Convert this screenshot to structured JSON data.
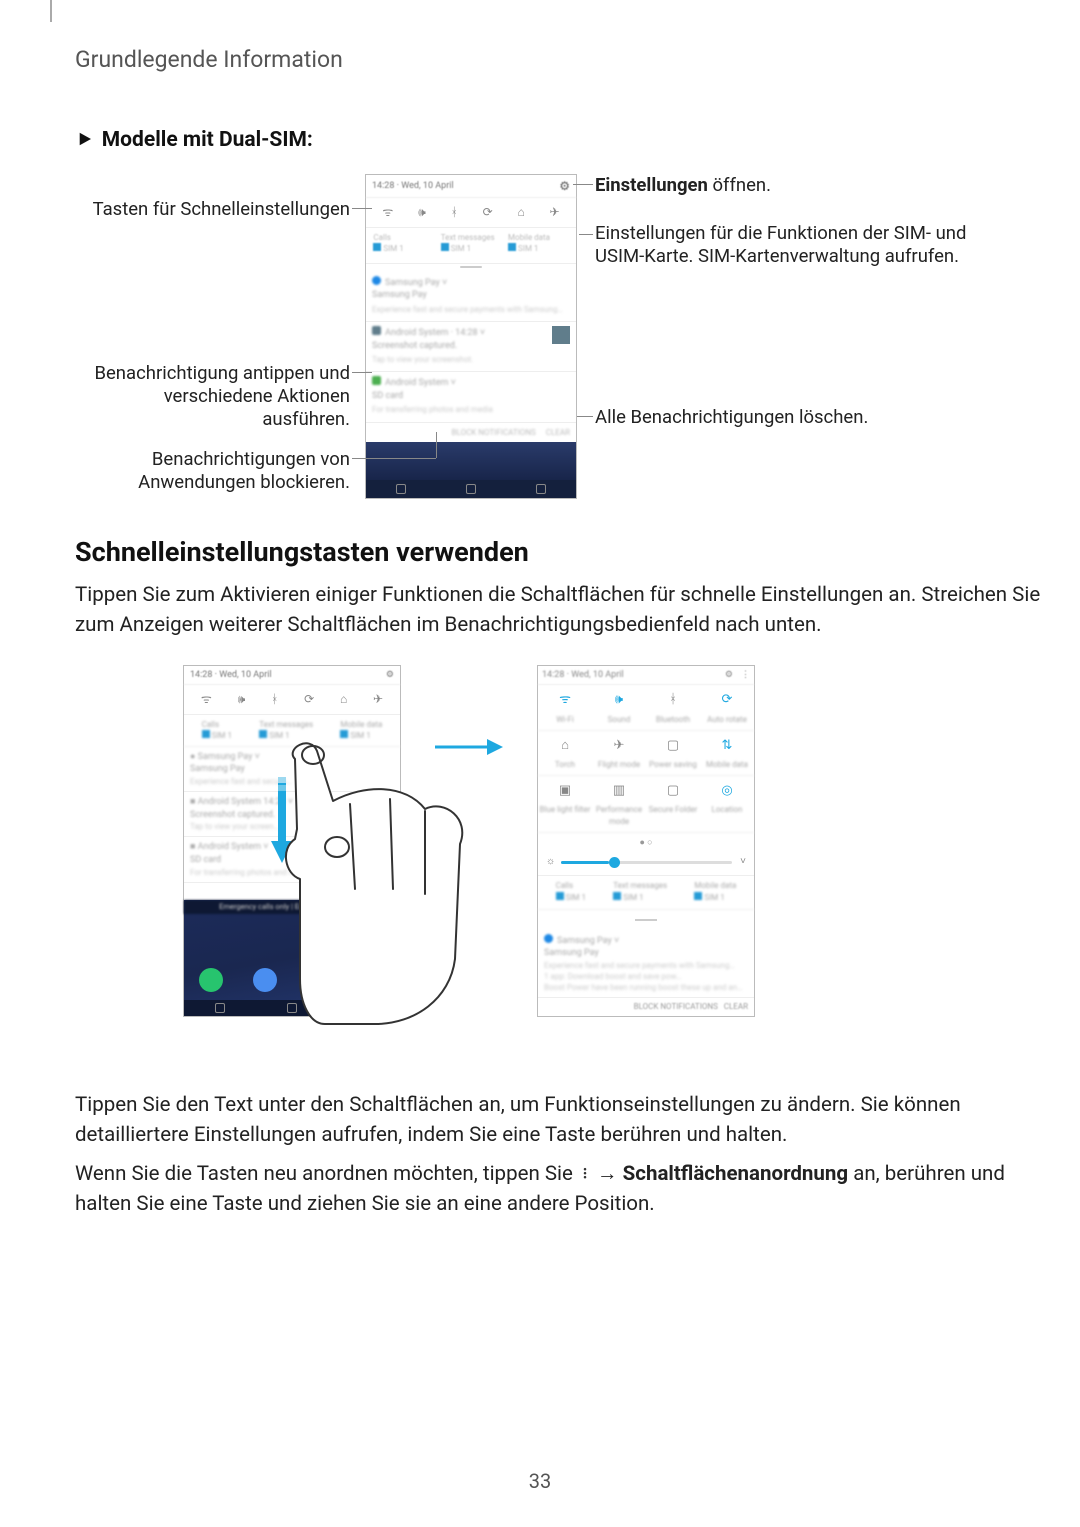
{
  "header": {
    "title": "Grundlegende Information"
  },
  "section_dual_sim": {
    "heading": "Modelle mit Dual-SIM:",
    "callouts_left": {
      "quick_settings_keys": "Tasten für Schnelleinstellungen",
      "notification_tap": "Benachrichtigung antippen und verschiedene Aktionen ausführen.",
      "block_apps": "Benachrichtigungen von Anwendungen blockieren."
    },
    "callouts_right": {
      "open_settings_pre": "Einstellungen",
      "open_settings_suf": " öffnen.",
      "sim_settings": "Einstellungen für die Funktionen der SIM- und USIM-Karte. SIM-Kartenverwaltung aufrufen.",
      "clear_all": "Alle Benachrichtigungen löschen."
    }
  },
  "section_quick": {
    "heading": "Schnelleinstellungstasten verwenden",
    "paragraph1": "Tippen Sie zum Aktivieren einiger Funktionen die Schaltflächen für schnelle Einstellungen an. Streichen Sie zum Anzeigen weiterer Schaltflächen im Benachrichtigungsbedienfeld nach unten.",
    "paragraph2": "Tippen Sie den Text unter den Schaltflächen an, um Funktionseinstellungen zu ändern. Sie können detailliertere Einstellungen aufrufen, indem Sie eine Taste berühren und halten.",
    "paragraph3_a": "Wenn Sie die Tasten neu anordnen möchten, tippen Sie ",
    "paragraph3_b": " → ",
    "paragraph3_c": "Schaltflächenanordnung",
    "paragraph3_d": " an, berühren und halten Sie eine Taste und ziehen Sie sie an eine andere Position."
  },
  "page_number": "33"
}
